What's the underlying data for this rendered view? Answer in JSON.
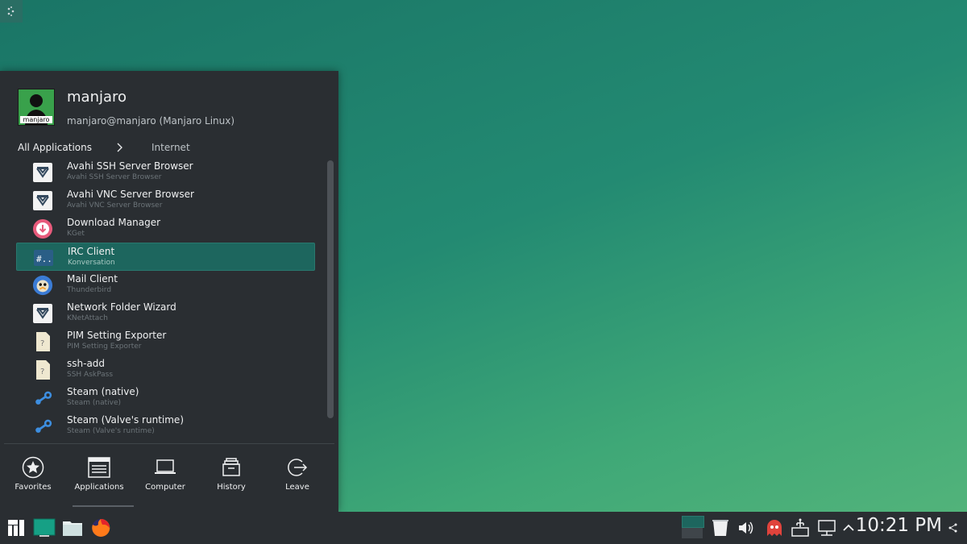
{
  "user": {
    "name": "manjaro",
    "subtitle": "manjaro@manjaro (Manjaro Linux)",
    "avatar_label": "manjaro"
  },
  "breadcrumb": {
    "root": "All Applications",
    "current": "Internet"
  },
  "apps": [
    {
      "name": "Avahi SSH Server Browser",
      "sub": "Avahi SSH Server Browser",
      "icon": "network-icon"
    },
    {
      "name": "Avahi VNC Server Browser",
      "sub": "Avahi VNC Server Browser",
      "icon": "network-icon"
    },
    {
      "name": "Download Manager",
      "sub": "KGet",
      "icon": "download-icon"
    },
    {
      "name": "IRC Client",
      "sub": "Konversation",
      "icon": "irc-icon",
      "selected": true
    },
    {
      "name": "Mail Client",
      "sub": "Thunderbird",
      "icon": "thunderbird-icon"
    },
    {
      "name": "Network Folder Wizard",
      "sub": "KNetAttach",
      "icon": "network-icon"
    },
    {
      "name": "PIM Setting Exporter",
      "sub": "PIM Setting Exporter",
      "icon": "unknown-file-icon"
    },
    {
      "name": "ssh-add",
      "sub": "SSH AskPass",
      "icon": "unknown-file-icon"
    },
    {
      "name": "Steam (native)",
      "sub": "Steam (native)",
      "icon": "steam-icon"
    },
    {
      "name": "Steam (Valve's runtime)",
      "sub": "Steam (Valve's runtime)",
      "icon": "steam-icon"
    }
  ],
  "tabs": [
    {
      "label": "Favorites",
      "icon": "star-icon"
    },
    {
      "label": "Applications",
      "icon": "applications-icon"
    },
    {
      "label": "Computer",
      "icon": "laptop-icon"
    },
    {
      "label": "History",
      "icon": "history-icon"
    },
    {
      "label": "Leave",
      "icon": "leave-icon"
    }
  ],
  "taskbar": {
    "clock": "10:21 PM"
  },
  "colors": {
    "accent": "#1d665e",
    "panel": "#2a2e32",
    "text": "#eff0f1"
  }
}
